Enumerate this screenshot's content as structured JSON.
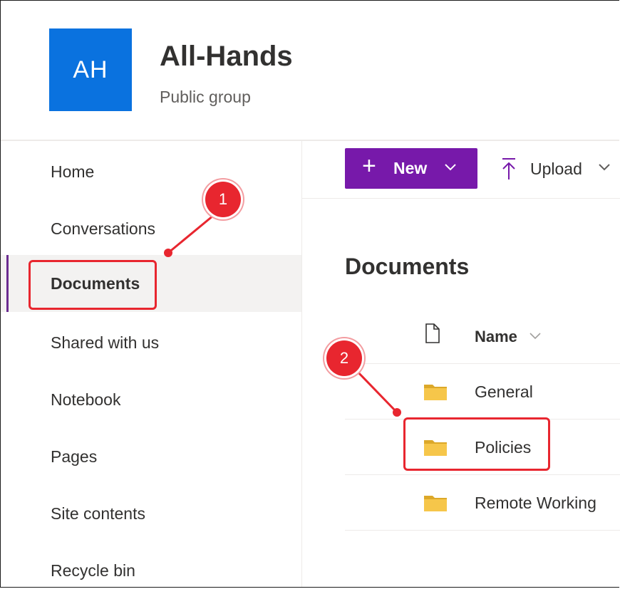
{
  "site": {
    "logo_initials": "AH",
    "title": "All-Hands",
    "subtitle": "Public group",
    "logo_color": "#0a72df"
  },
  "nav": {
    "items": [
      {
        "label": "Home"
      },
      {
        "label": "Conversations"
      },
      {
        "label": "Documents",
        "selected": true
      },
      {
        "label": "Shared with us"
      },
      {
        "label": "Notebook"
      },
      {
        "label": "Pages"
      },
      {
        "label": "Site contents"
      },
      {
        "label": "Recycle bin"
      }
    ]
  },
  "command_bar": {
    "new_label": "New",
    "upload_label": "Upload",
    "new_color": "#7719aa"
  },
  "library": {
    "title": "Documents",
    "column_name": "Name",
    "rows": [
      {
        "name": "General",
        "icon": "folder-icon"
      },
      {
        "name": "Policies",
        "icon": "folder-icon"
      },
      {
        "name": "Remote Working",
        "icon": "folder-icon"
      }
    ]
  },
  "annotations": {
    "step1": "1",
    "step2": "2",
    "color": "#e8262f"
  }
}
